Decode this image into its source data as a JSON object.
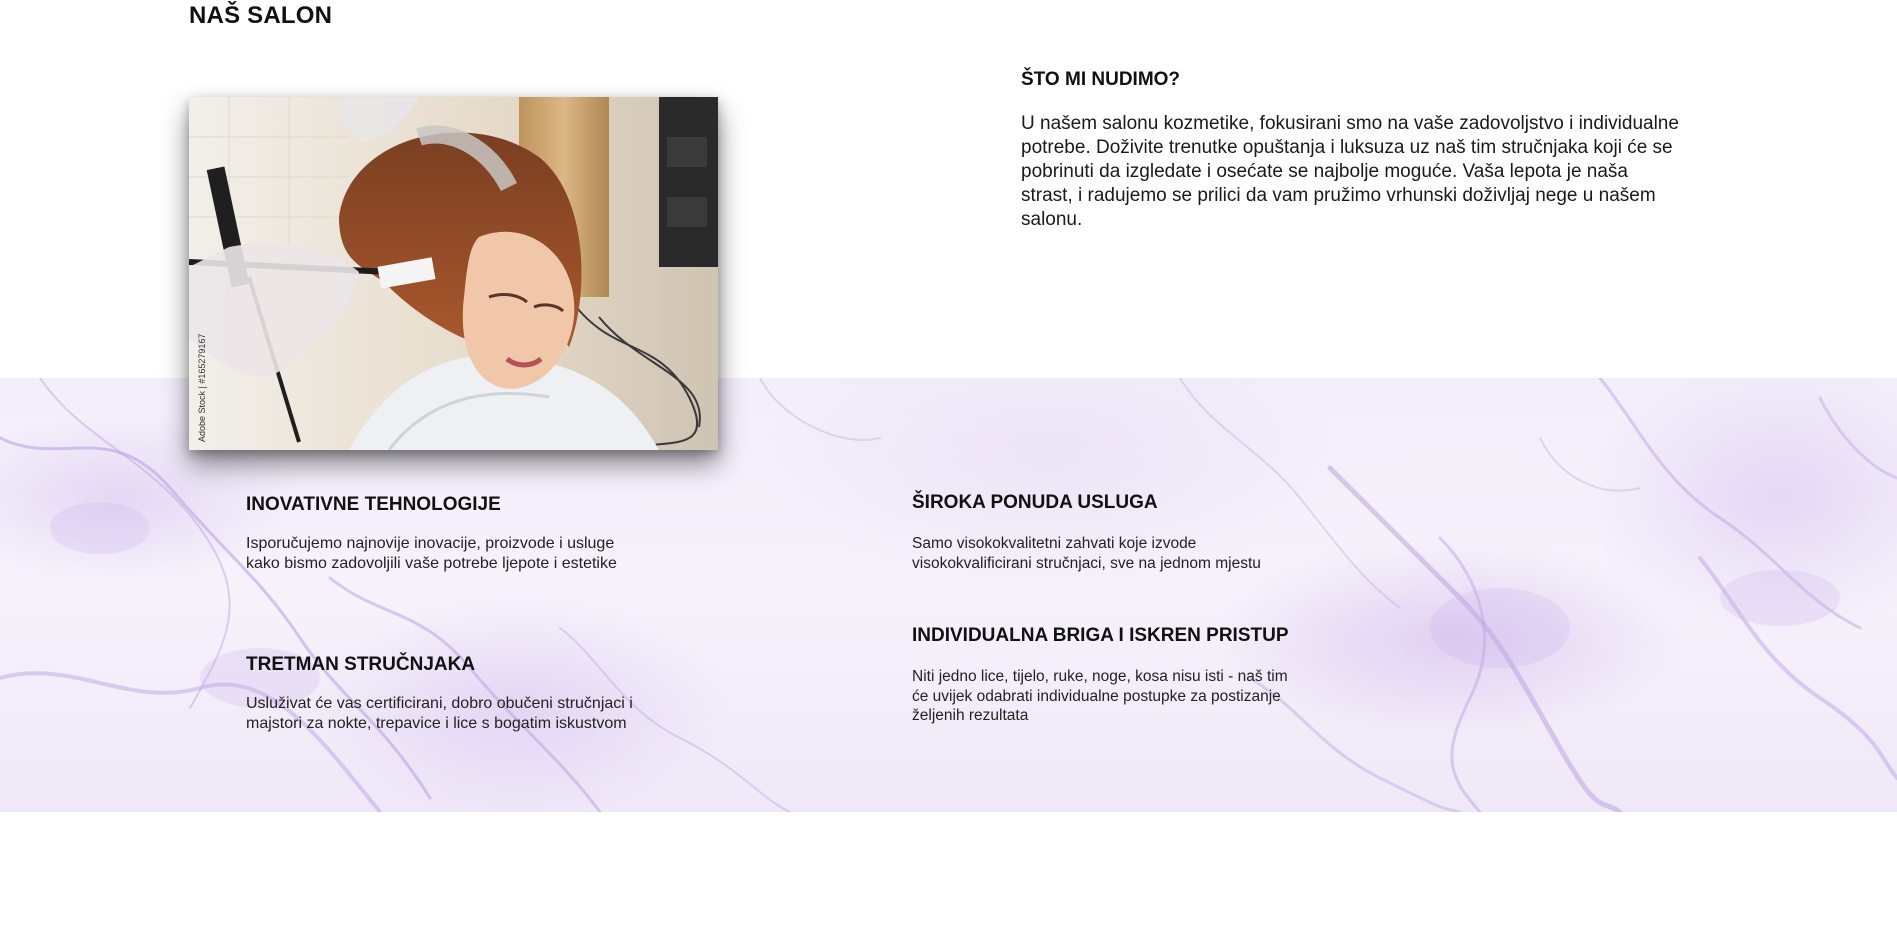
{
  "section": {
    "title": "NAŠ SALON"
  },
  "photo": {
    "watermark": "Adobe Stock | #165279167"
  },
  "offer": {
    "title": "ŠTO MI NUDIMO?",
    "text": "U našem salonu kozmetike, fokusirani smo na vaše zadovoljstvo i individualne potrebe. Doživite trenutke opuštanja i luksuza uz naš tim stručnjaka koji će se pobrinuti da izgledate i osećate se najbolje moguće. Vaša lepota je naša strast, i radujemo se prilici da vam pružimo vrhunski doživljaj nege u našem salonu."
  },
  "features": [
    {
      "title": "INOVATIVNE TEHNOLOGIJE",
      "text": "Isporučujemo najnovije inovacije, proizvode i usluge kako bismo zadovoljili vaše potrebe ljepote i estetike"
    },
    {
      "title": "TRETMAN STRUČNJAKA",
      "text": "Usluživat će vas certificirani, dobro obučeni stručnjaci i majstori za nokte, trepavice i lice s bogatim iskustvom"
    },
    {
      "title": "ŠIROKA PONUDA USLUGA",
      "text": "Samo visokokvalitetni zahvati koje izvode visokokvalificirani stručnjaci, sve na jednom mjestu"
    },
    {
      "title": "INDIVIDUALNA BRIGA I ISKREN PRISTUP",
      "text": "Niti jedno lice, tijelo, ruke, noge, kosa nisu isti - naš tim će uvijek odabrati individualne postupke za postizanje željenih rezultata"
    }
  ],
  "colors": {
    "marble_base": "#f4effa",
    "marble_vein": "#b79ee0",
    "heading": "#111111"
  }
}
